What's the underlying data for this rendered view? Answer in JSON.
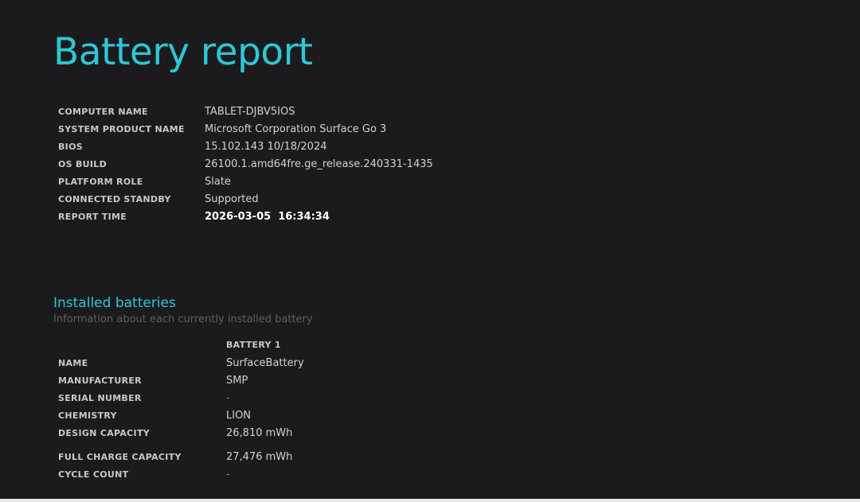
{
  "report": {
    "title": "Battery report"
  },
  "system_info": [
    {
      "label": "COMPUTER NAME",
      "value": "TABLET-DJBV5IOS"
    },
    {
      "label": "SYSTEM PRODUCT NAME",
      "value": "Microsoft Corporation Surface Go 3"
    },
    {
      "label": "BIOS",
      "value": "15.102.143 10/18/2024"
    },
    {
      "label": "OS BUILD",
      "value": "26100.1.amd64fre.ge_release.240331-1435"
    },
    {
      "label": "PLATFORM ROLE",
      "value": "Slate"
    },
    {
      "label": "CONNECTED STANDBY",
      "value": "Supported"
    },
    {
      "label": "REPORT TIME",
      "value": "2026-03-05  16:34:34"
    }
  ],
  "installed_batteries": {
    "heading": "Installed batteries",
    "subheading": "Information about each currently installed battery",
    "column_header": "BATTERY 1",
    "rows": [
      {
        "label": "NAME",
        "value": "SurfaceBattery"
      },
      {
        "label": "MANUFACTURER",
        "value": "SMP"
      },
      {
        "label": "SERIAL NUMBER",
        "value": "-"
      },
      {
        "label": "CHEMISTRY",
        "value": "LION"
      },
      {
        "label": "DESIGN CAPACITY",
        "value": "26,810 mWh"
      },
      {
        "label": "FULL CHARGE CAPACITY",
        "value": "27,476 mWh"
      },
      {
        "label": "CYCLE COUNT",
        "value": "-"
      }
    ]
  },
  "colors": {
    "background": "#1b1b1d",
    "accent": "#2ec7d6",
    "label": "#c8c8c8",
    "value": "#d2d2d2",
    "subtle": "#5f5f63"
  }
}
